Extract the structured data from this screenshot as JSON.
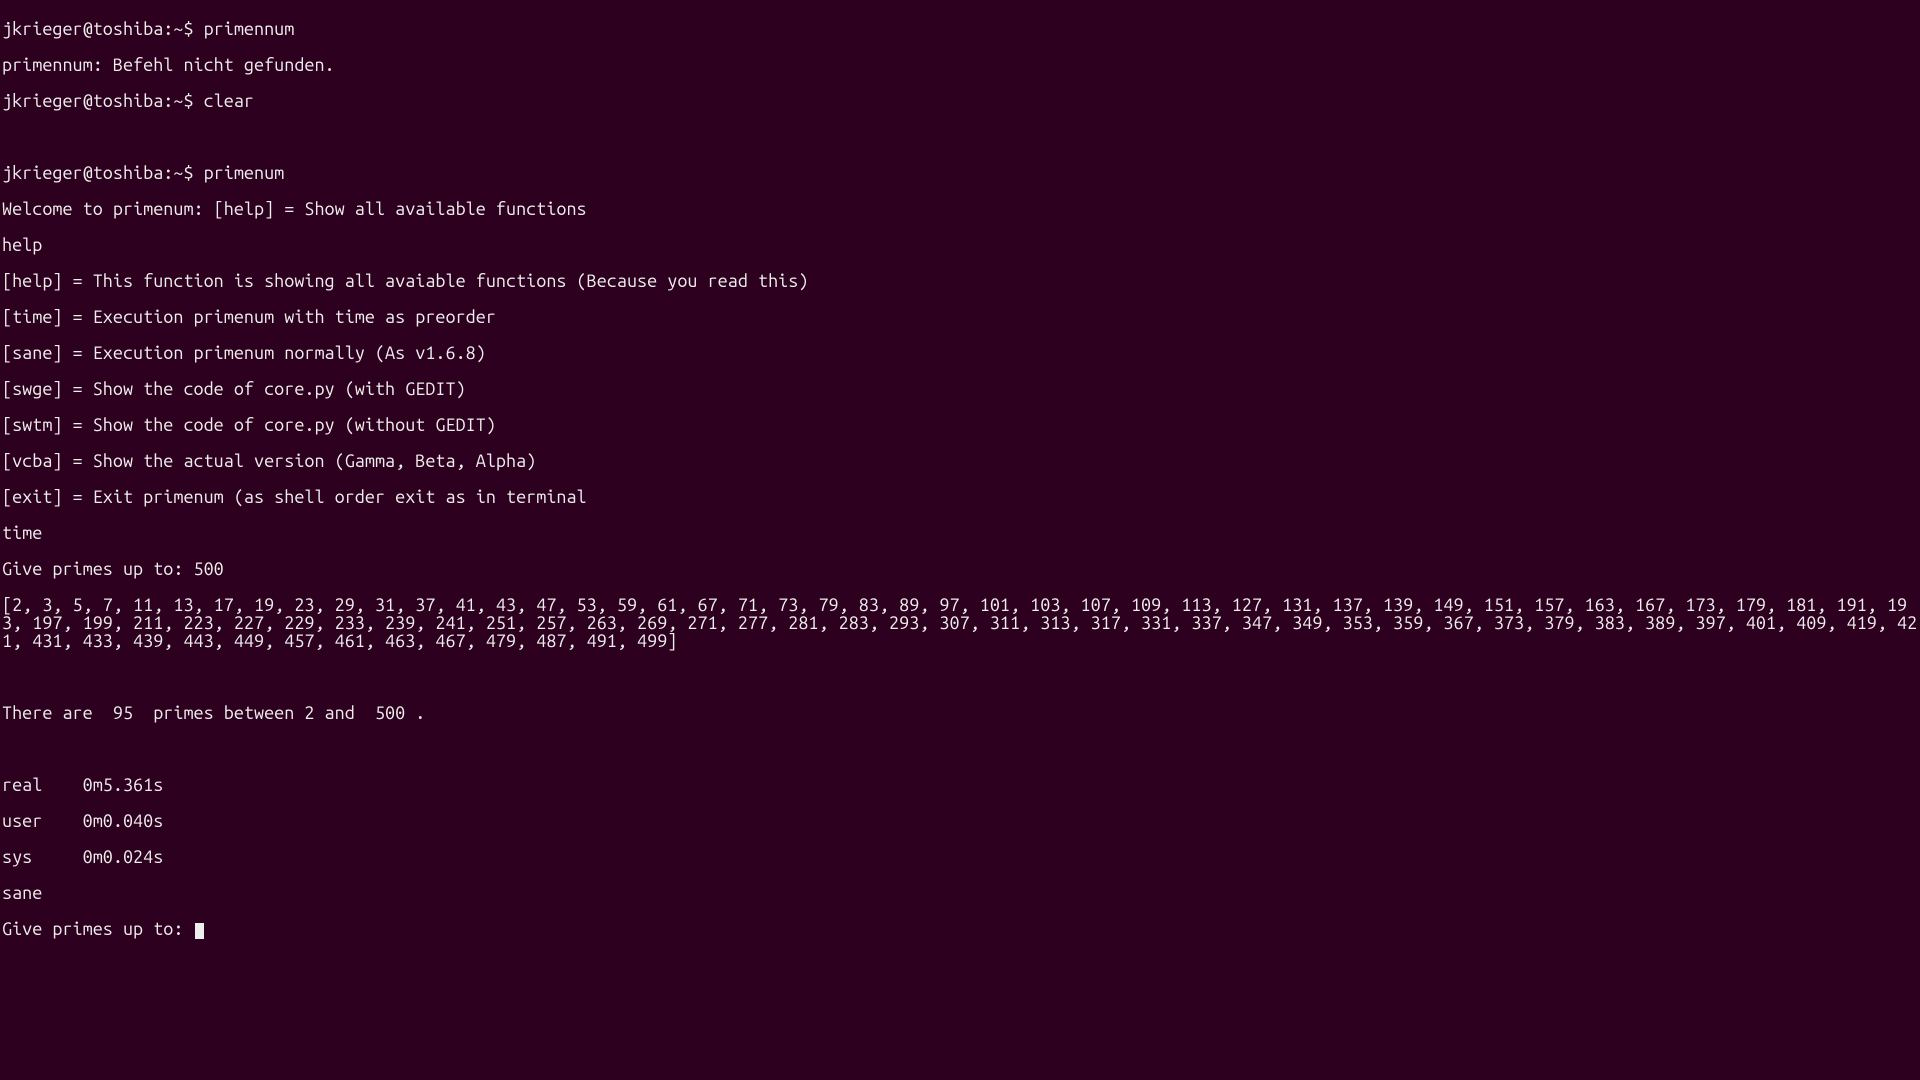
{
  "prompt": "jkrieger@toshiba:~$ ",
  "lines": {
    "l1_cmd": "primennum",
    "l2": "primennum: Befehl nicht gefunden.",
    "l3_cmd": "clear",
    "l4": "",
    "l5_cmd": "primenum",
    "l6": "Welcome to primenum: [help] = Show all available functions",
    "l7": "help",
    "l8": "[help] = This function is showing all avaiable functions (Because you read this)",
    "l9": "[time] = Execution primenum with time as preorder",
    "l10": "[sane] = Execution primenum normally (As v1.6.8)",
    "l11": "[swge] = Show the code of core.py (with GEDIT)",
    "l12": "[swtm] = Show the code of core.py (without GEDIT)",
    "l13": "[vcba] = Show the actual version (Gamma, Beta, Alpha)",
    "l14": "[exit] = Exit primenum (as shell order exit as in terminal",
    "l15": "time",
    "l16": "Give primes up to: 500",
    "l17": "[2, 3, 5, 7, 11, 13, 17, 19, 23, 29, 31, 37, 41, 43, 47, 53, 59, 61, 67, 71, 73, 79, 83, 89, 97, 101, 103, 107, 109, 113, 127, 131, 137, 139, 149, 151, 157, 163, 167, 173, 179, 181, 191, 193, 197, 199, 211, 223, 227, 229, 233, 239, 241, 251, 257, 263, 269, 271, 277, 281, 283, 293, 307, 311, 313, 317, 331, 337, 347, 349, 353, 359, 367, 373, 379, 383, 389, 397, 401, 409, 419, 421, 431, 433, 439, 443, 449, 457, 461, 463, 467, 479, 487, 491, 499]",
    "l18": "",
    "l19": "There are  95  primes between 2 and  500 .",
    "l20": "",
    "l21": "real    0m5.361s",
    "l22": "user    0m0.040s",
    "l23": "sys     0m0.024s",
    "l24": "sane",
    "l25": "Give primes up to: "
  }
}
